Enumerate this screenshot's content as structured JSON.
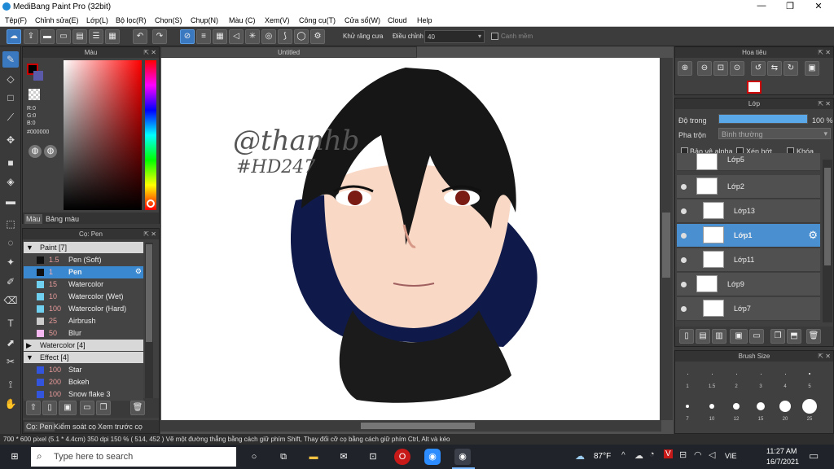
{
  "window": {
    "title": "MediBang Paint Pro (32bit)",
    "min": "—",
    "max": "❐",
    "close": "✕"
  },
  "menu": [
    "Tệp(F)",
    "Chỉnh sửa(E)",
    "Lớp(L)",
    "Bộ lọc(R)",
    "Chọn(S)",
    "Chụp(N)",
    "Màu (C)",
    "Xem(V)",
    "Công cụ(T)",
    "Cửa sổ(W)",
    "Cloud",
    "Help"
  ],
  "toolbar": {
    "antialias": "Khử răng cưa",
    "correction_label": "Điều chỉnh",
    "correction_value": "40",
    "snap": "Canh mềm"
  },
  "color_panel": {
    "title": "Màu",
    "r": "R:0",
    "g": "G:0",
    "b": "B:0",
    "hex": "#000000",
    "tab_color": "Màu",
    "tab_palette": "Bảng màu"
  },
  "brush_panel": {
    "title": "Cọ: Pen",
    "groups": [
      {
        "label": "Paint [7]",
        "expanded": true,
        "items": [
          {
            "size": "1.5",
            "name": "Pen (Soft)",
            "color": "#111111",
            "selected": false
          },
          {
            "size": "1",
            "name": "Pen",
            "color": "#111111",
            "selected": true
          },
          {
            "size": "15",
            "name": "Watercolor",
            "color": "#6fd0f0",
            "selected": false
          },
          {
            "size": "10",
            "name": "Watercolor (Wet)",
            "color": "#6fd0f0",
            "selected": false
          },
          {
            "size": "100",
            "name": "Watercolor (Hard)",
            "color": "#6fd0f0",
            "selected": false
          },
          {
            "size": "25",
            "name": "Airbrush",
            "color": "#cccccc",
            "selected": false
          },
          {
            "size": "50",
            "name": "Blur",
            "color": "#f5b8f0",
            "selected": false
          }
        ]
      },
      {
        "label": "Watercolor [4]",
        "expanded": false,
        "items": []
      },
      {
        "label": "Effect [4]",
        "expanded": true,
        "items": [
          {
            "size": "100",
            "name": "Star",
            "color": "#3355dd",
            "selected": false
          },
          {
            "size": "200",
            "name": "Bokeh",
            "color": "#3355dd",
            "selected": false
          },
          {
            "size": "100",
            "name": "Snow flake 3",
            "color": "#3355dd",
            "selected": false
          }
        ]
      }
    ],
    "tabs": [
      "Cọ: Pen",
      "Kiểm soát cọ",
      "Xem trước cọ"
    ]
  },
  "canvas": {
    "tab": "Untitled",
    "signature_line1": "@thanhb",
    "signature_line2": "#HD247"
  },
  "navigator": {
    "title": "Hoa tiêu"
  },
  "layer_panel": {
    "title": "Lớp",
    "opacity_label": "Độ trong",
    "opacity_value": "100 %",
    "opacity_fraction": 1.0,
    "blend_label": "Pha trộn",
    "blend_value": "Bình thường",
    "protect_alpha": "Bảo vệ alpha",
    "clipping": "Xén bớt",
    "lock": "Khóa",
    "layers": [
      {
        "name": "Lớp5",
        "selected": false
      },
      {
        "name": "Lớp2",
        "selected": false
      },
      {
        "name": "Lớp13",
        "selected": false
      },
      {
        "name": "Lớp1",
        "selected": true
      },
      {
        "name": "Lớp11",
        "selected": false
      },
      {
        "name": "Lớp9",
        "selected": false
      },
      {
        "name": "Lớp7",
        "selected": false
      }
    ]
  },
  "brush_size_panel": {
    "title": "Brush Size",
    "sizes": [
      "1",
      "1.5",
      "2",
      "3",
      "4",
      "5",
      "7",
      "10",
      "12",
      "15",
      "20",
      "25"
    ]
  },
  "status": "700 * 600 pixel   (5.1 * 4.4cm)   350 dpi   150 %   ( 514, 452 )   Vẽ một đường thẳng bằng cách giữ phím Shift, Thay đổi cỡ cọ bằng cách giữ phím Ctrl, Alt và kéo",
  "taskbar": {
    "search_placeholder": "Type here to search",
    "weather": "87°F",
    "lang": "VIE",
    "time": "11:27 AM",
    "date": "16/7/2021"
  }
}
